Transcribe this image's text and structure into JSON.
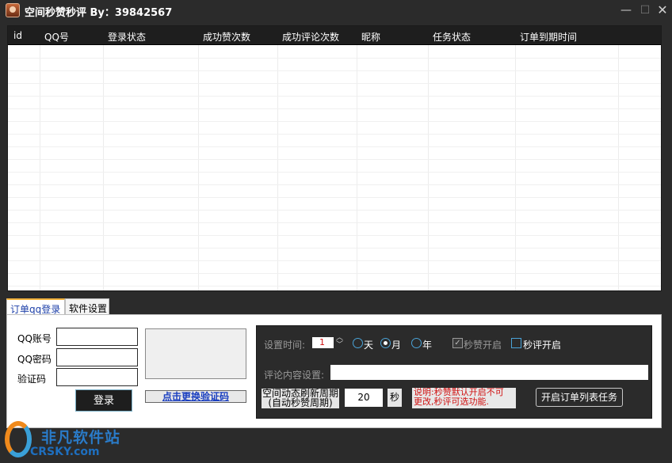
{
  "window": {
    "title": "空间秒赞秒评 By：39842567",
    "minimize": "—",
    "maximize": "☐",
    "close": "✕"
  },
  "table": {
    "columns": [
      "id",
      "QQ号",
      "登录状态",
      "成功赞次数",
      "成功评论次数",
      "昵称",
      "任务状态",
      "订单到期时间"
    ],
    "rows": []
  },
  "tabs": [
    {
      "label": "订单qq登录",
      "active": true
    },
    {
      "label": "软件设置",
      "active": false
    }
  ],
  "login": {
    "qq_label": "QQ账号",
    "password_label": "QQ密码",
    "captcha_label": "验证码",
    "qq_value": "",
    "password_value": "",
    "captcha_value": "",
    "login_button": "登录",
    "refresh_captcha_button": "点击更换验证码"
  },
  "settings": {
    "time_label": "设置时间:",
    "time_value": "1",
    "units": [
      {
        "label": "天",
        "selected": false
      },
      {
        "label": "月",
        "selected": true
      },
      {
        "label": "年",
        "selected": false
      }
    ],
    "like_toggle": {
      "label": "秒赞开启",
      "checked": true,
      "disabled": true
    },
    "comment_toggle": {
      "label": "秒评开启",
      "checked": false
    },
    "comment_content_label": "评论内容设置:",
    "comment_content_value": "",
    "refresh_period_label_line1": "空间动态刷新周期",
    "refresh_period_label_line2": "(自动秒赞周期)",
    "refresh_period_value": "20",
    "seconds_label": "秒",
    "note_line1": "说明:秒赞默认开启不可",
    "note_line2": "更改,秒评可选功能.",
    "start_button": "开启订单列表任务"
  },
  "watermark": {
    "cn": "非凡软件站",
    "en": "CRSKY.com",
    "colors": {
      "orange": "#f08a1c",
      "blue": "#2a7bc8"
    }
  }
}
